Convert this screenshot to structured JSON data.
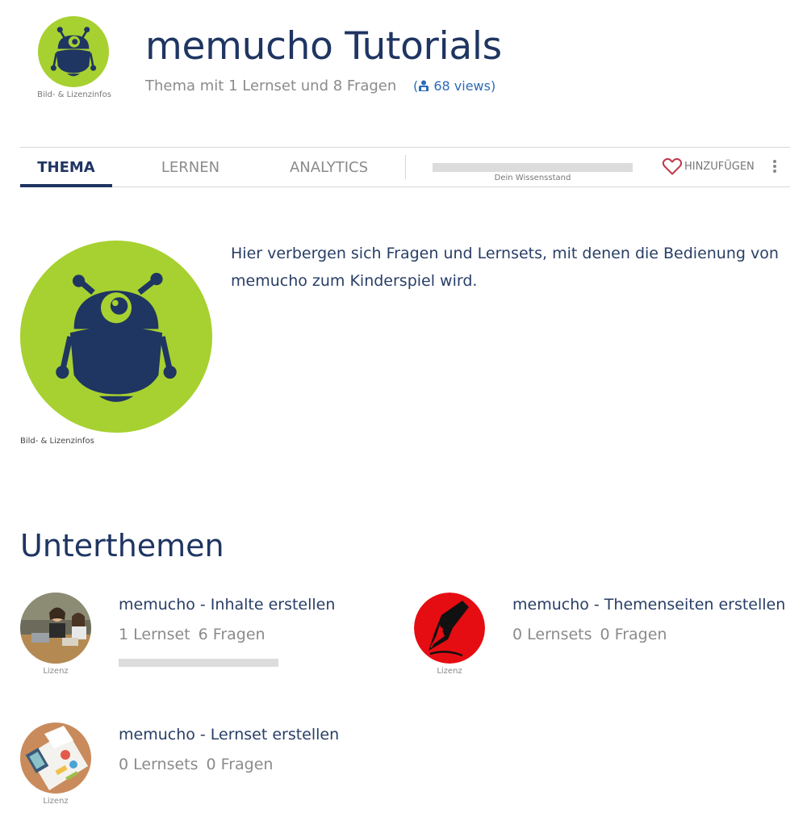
{
  "header": {
    "title": "memucho Tutorials",
    "subtitle": "Thema mit 1 Lernset und 8 Fragen",
    "views": "68 views",
    "logo_caption": "Bild- & Lizenzinfos",
    "logo_icon": "robot-icon"
  },
  "tabs": [
    {
      "label": "THEMA",
      "active": true
    },
    {
      "label": "LERNEN",
      "active": false
    },
    {
      "label": "ANALYTICS",
      "active": false
    }
  ],
  "knowledge": {
    "label": "Dein Wissensstand",
    "progress": 0
  },
  "actions": {
    "add_label": "HINZUFÜGEN",
    "add_icon": "heart-icon",
    "menu_icon": "vertical-dots-icon"
  },
  "intro": {
    "text": "Hier verbergen sich Fragen und Lernsets, mit denen die Bedienung von memucho zum Kinderspiel wird.",
    "image_caption": "Bild- & Lizenzinfos"
  },
  "subtopics": {
    "title": "Unterthemen",
    "items": [
      {
        "name": "memucho - Inhalte erstellen",
        "lernsets": "1 Lernset",
        "fragen": "6 Fragen",
        "license": "Lizenz",
        "progress": 0
      },
      {
        "name": "memucho - Themenseiten erstellen",
        "lernsets": "0 Lernsets",
        "fragen": "0 Fragen",
        "license": "Lizenz"
      },
      {
        "name": "memucho - Lernset erstellen",
        "lernsets": "0 Lernsets",
        "fragen": "0 Fragen",
        "license": "Lizenz"
      }
    ]
  },
  "colors": {
    "brand_navy": "#1f3562",
    "brand_green": "#a7d130",
    "link_blue": "#2c6bb8",
    "heart_red": "#c0394b"
  }
}
